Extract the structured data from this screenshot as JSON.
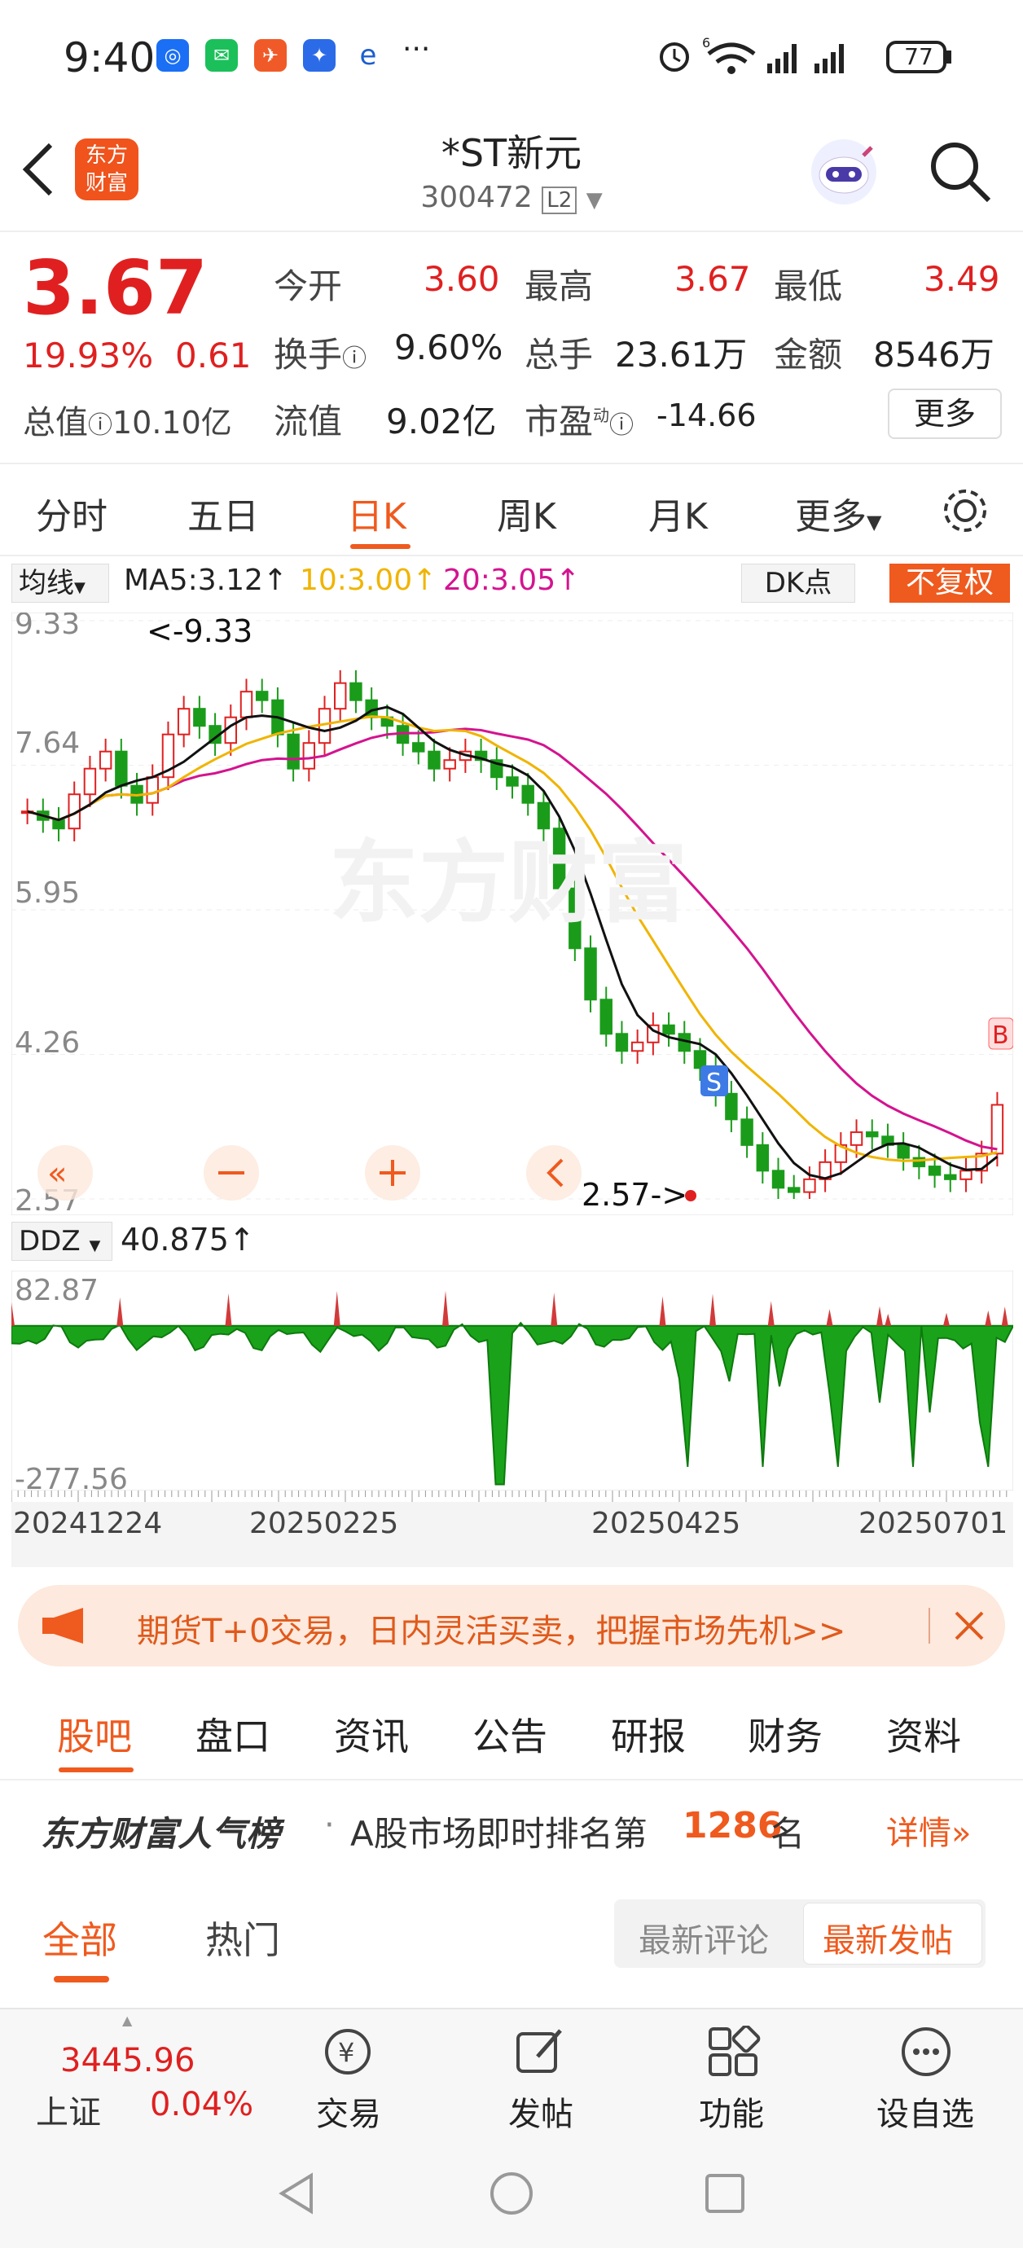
{
  "status_bar": {
    "time": "9:40",
    "battery": "77",
    "icons": [
      "dingtalk-icon",
      "wechat-icon",
      "fleet-icon",
      "mail-icon",
      "browser-icon",
      "more-dots-icon",
      "alarm-icon",
      "wifi-icon",
      "signal-icon",
      "signal-icon",
      "battery-icon"
    ],
    "more": "···",
    "wifi_badge": "6"
  },
  "header": {
    "logo_line1": "东方",
    "logo_line2": "财富",
    "title": "*ST新元",
    "code": "300472",
    "level": "L2"
  },
  "quote": {
    "price": "3.67",
    "pct": "19.93%",
    "chg": "0.61",
    "open_label": "今开",
    "open": "3.60",
    "high_label": "最高",
    "high": "3.67",
    "low_label": "最低",
    "low": "3.49",
    "turnover_label": "换手",
    "turnover": "9.60%",
    "vol_label": "总手",
    "vol": "23.61万",
    "amount_label": "金额",
    "amount": "8546万",
    "mcap_label": "总值",
    "mcap": "10.10亿",
    "float_label": "流值",
    "float": "9.02亿",
    "pe_label": "市盈",
    "pe_sup": "动",
    "pe": "-14.66",
    "more_btn": "更多"
  },
  "period_tabs": [
    "分时",
    "五日",
    "日K",
    "周K",
    "月K",
    "更多"
  ],
  "chart": {
    "ind_select": "均线",
    "ma5": "MA5:3.12↑",
    "ma10": "10:3.00↑",
    "ma20": "20:3.05↑",
    "dk_btn": "DK点",
    "fq_btn": "不复权",
    "y_labels": [
      "9.33",
      "7.64",
      "5.95",
      "4.26",
      "2.57"
    ],
    "max_note": "<-9.33",
    "min_note": "2.57->",
    "sub_select": "DDZ",
    "sub_value": "40.875↑",
    "sub_top": "82.87",
    "sub_bottom": "-277.56",
    "dates": [
      "20241224",
      "20250225",
      "20250425",
      "20250701"
    ],
    "watermark": "东方财富",
    "s_mark": "S",
    "b_mark": "B",
    "ctrl_icons": [
      "fast-back-icon",
      "zoom-out-icon",
      "zoom-in-icon",
      "back-icon"
    ]
  },
  "chart_data": {
    "type": "candlestick",
    "y_range": [
      2.57,
      9.33
    ],
    "high": 9.33,
    "low": 2.57,
    "moving_averages": {
      "MA5": 3.12,
      "MA10": 3.0,
      "MA20": 3.05
    },
    "x_labels": [
      "20241224",
      "20250225",
      "20250425",
      "20250701"
    ],
    "close_approx": [
      7.1,
      7.0,
      6.9,
      7.3,
      7.6,
      7.8,
      7.4,
      7.2,
      7.5,
      8.0,
      8.3,
      8.1,
      7.9,
      8.2,
      8.5,
      8.4,
      8.0,
      7.6,
      7.9,
      8.3,
      8.6,
      8.4,
      8.2,
      8.1,
      7.9,
      7.8,
      7.6,
      7.7,
      7.8,
      7.7,
      7.5,
      7.4,
      7.2,
      6.9,
      6.2,
      5.5,
      4.9,
      4.5,
      4.3,
      4.4,
      4.6,
      4.5,
      4.3,
      4.1,
      3.8,
      3.5,
      3.2,
      2.9,
      2.7,
      2.65,
      2.8,
      3.0,
      3.2,
      3.35,
      3.3,
      3.2,
      3.05,
      2.95,
      2.85,
      2.8,
      2.9,
      3.1,
      3.67
    ],
    "ddz_range": [
      -277.56,
      82.87
    ],
    "ddz_last": 40.875
  },
  "banner": {
    "text": "期货T+0交易，日内灵活买卖，把握市场先机>>"
  },
  "section_tabs": [
    "股吧",
    "盘口",
    "资讯",
    "公告",
    "研报",
    "财务",
    "资料"
  ],
  "rank": {
    "brand": "东方财富人气榜",
    "dot": "·",
    "text1": "A股市场即时排名第",
    "rank": "1286",
    "text2": "名",
    "detail": "详情"
  },
  "feed_tabs": {
    "all": "全部",
    "hot": "热门",
    "latest_comment": "最新评论",
    "latest_post": "最新发帖"
  },
  "footer": {
    "index_value": "3445.96",
    "index_name": "上证",
    "index_pct": "0.04%",
    "trade": "交易",
    "post": "发帖",
    "func": "功能",
    "watch": "设自选"
  }
}
